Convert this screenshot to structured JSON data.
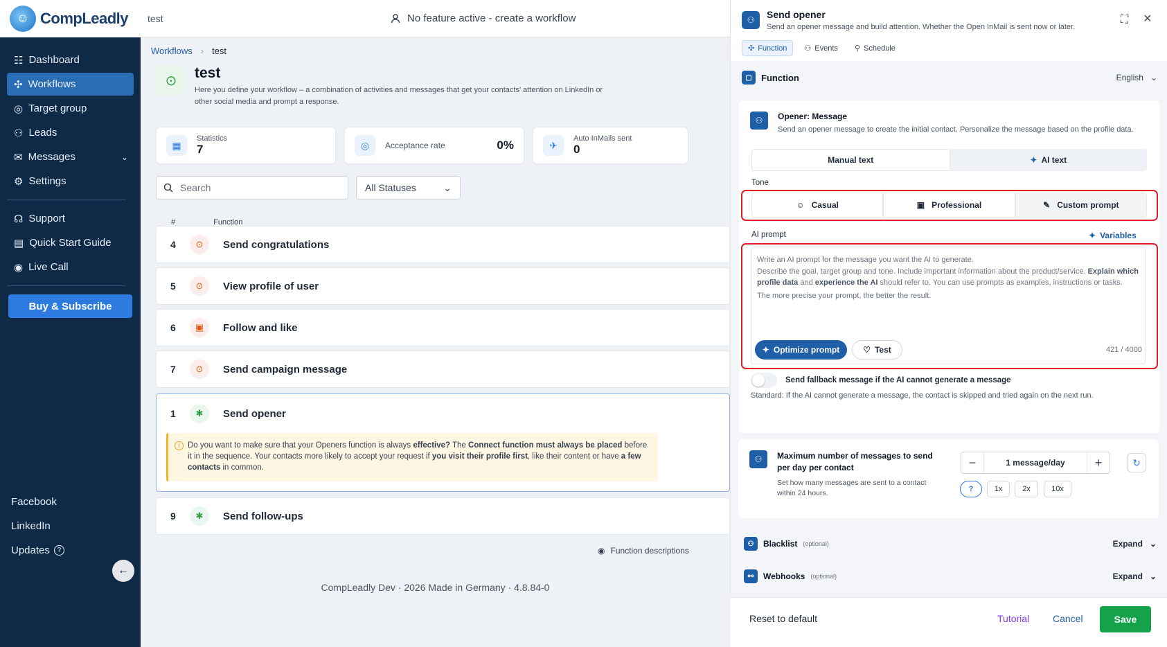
{
  "topbar": {
    "brand": "CompLeadly",
    "page": "test",
    "status": "No feature active - create a workflow"
  },
  "sidebar": {
    "items": [
      {
        "label": "Dashboard",
        "icon": "dashboard-icon"
      },
      {
        "label": "Workflows",
        "icon": "workflow-icon",
        "active": true
      },
      {
        "label": "Target group",
        "icon": "target-icon"
      },
      {
        "label": "Leads",
        "icon": "users-icon"
      },
      {
        "label": "Messages",
        "icon": "chat-icon"
      },
      {
        "label": "Settings",
        "icon": "gear-icon"
      }
    ],
    "support_items": [
      {
        "label": "Support",
        "icon": "support-icon"
      },
      {
        "label": "Quick Start Guide",
        "icon": "book-icon"
      },
      {
        "label": "Live Call",
        "icon": "phone-icon"
      }
    ],
    "buy_label": "Buy & Subscribe",
    "social": [
      "Facebook",
      "LinkedIn",
      "Updates"
    ]
  },
  "main": {
    "breadcrumb": [
      "Workflows",
      "test"
    ],
    "title": "test",
    "description": "Here you define your workflow – a combination of activities and messages that get your contacts' attention on LinkedIn or other social media and prompt a response.",
    "stats": [
      {
        "label": "Statistics",
        "value": "7"
      },
      {
        "label": "Acceptance rate",
        "value": "0%"
      },
      {
        "label": "Auto InMails sent",
        "value": "0"
      }
    ],
    "search_placeholder": "Search",
    "status_filter": "All Statuses",
    "columns": [
      "#",
      "Function"
    ],
    "rows": [
      {
        "num": "4",
        "label": "Send congratulations"
      },
      {
        "num": "5",
        "label": "View profile of user"
      },
      {
        "num": "6",
        "label": "Follow and like"
      },
      {
        "num": "7",
        "label": "Send campaign message"
      },
      {
        "num": "1",
        "label": "Send opener"
      },
      {
        "num": "9",
        "label": "Send follow-ups"
      }
    ],
    "notice": {
      "t1": "Do you want to make sure that your Openers function is always ",
      "b1": "effective?",
      "t2": " The ",
      "b2": "Connect function must always be placed",
      "t3": " before it in the sequence. Your contacts more likely to accept your request if ",
      "b3": "you visit their profile first",
      "t4": ", like their content or have ",
      "b4": "a few contacts",
      "t5": " in common."
    },
    "function_descriptions": "Function descriptions",
    "footer": "CompLeadly Dev · 2026 Made in Germany · 4.8.84-0"
  },
  "panel": {
    "title": "Send opener",
    "subtitle": "Send an opener message and build attention. Whether the Open InMail is sent now or later.",
    "tabs": [
      "Function",
      "Events",
      "Schedule"
    ],
    "section_title": "Function",
    "language": "English",
    "opener_title": "Opener: Message",
    "opener_sub": "Send an opener message to create the initial contact. Personalize the message based on the profile data.",
    "mode_options": [
      "Manual text",
      "AI text"
    ],
    "tone_label": "Tone",
    "tones": [
      "Casual",
      "Professional",
      "Custom prompt"
    ],
    "ai_prompt_label": "AI prompt",
    "variables": "Variables",
    "prompt": {
      "l1": "Write an AI prompt for the message you want the AI to generate.",
      "l2a": "Describe the goal, target group and tone. Include important information about the product/service. ",
      "l2b": "Explain which profile data",
      "l2c": " and ",
      "l2d": "experience the AI",
      "l2e": " should refer to. You can use prompts as examples, instructions or tasks.",
      "l3": "The more precise your prompt, the better the result."
    },
    "optimize_label": "Optimize prompt",
    "test_label": "Test",
    "counter": "421 / 4000",
    "fallback_label": "Send fallback message if the AI cannot generate a message",
    "fallback_desc": "Standard: If the AI cannot generate a message, the contact is skipped and tried again on the next run.",
    "max_title": "Maximum number of messages to send per day per contact",
    "max_sub": "Set how many messages are sent to a contact within 24 hours.",
    "stepper_value": "1 message/day",
    "multipliers": [
      "1x",
      "2x",
      "10x"
    ],
    "optional_sections": [
      {
        "label": "Blacklist",
        "optional": "(optional)",
        "action": "Expand"
      },
      {
        "label": "Webhooks",
        "optional": "(optional)",
        "action": "Expand"
      }
    ],
    "footer": {
      "reset": "Reset to default",
      "tutorial": "Tutorial",
      "cancel": "Cancel",
      "save": "Save"
    }
  }
}
